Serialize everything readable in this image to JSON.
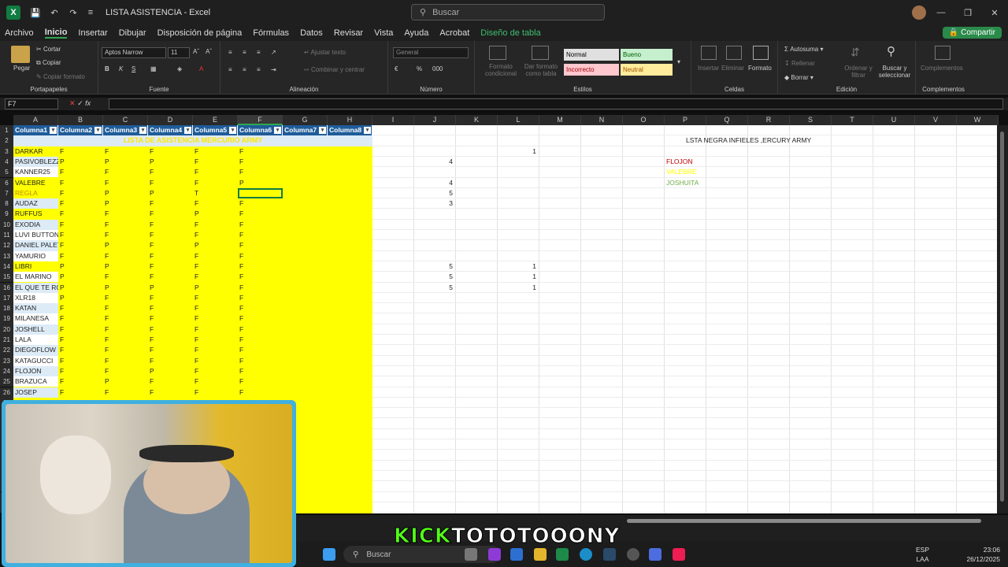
{
  "app": {
    "title": "LISTA ASISTENCIA",
    "app_name": "Excel",
    "search_placeholder": "Buscar"
  },
  "menu": {
    "items": [
      "Archivo",
      "Inicio",
      "Insertar",
      "Dibujar",
      "Disposición de página",
      "Fórmulas",
      "Datos",
      "Revisar",
      "Vista",
      "Ayuda",
      "Acrobat",
      "Diseño de tabla"
    ],
    "active": "Inicio",
    "share_label": "Compartir"
  },
  "ribbon": {
    "clipboard": {
      "paste": "Pegar",
      "cut": "Cortar",
      "copy": "Copiar",
      "format_painter": "Copiar formato",
      "label": "Portapapeles"
    },
    "font": {
      "name": "Aptos Narrow",
      "size": "11",
      "label": "Fuente"
    },
    "alignment": {
      "wrap": "Ajustar texto",
      "merge": "Combinar y centrar",
      "label": "Alineación"
    },
    "number": {
      "format": "General",
      "label": "Número"
    },
    "styles": {
      "cond": "Formato condicional",
      "table": "Dar formato como tabla",
      "normal": "Normal",
      "good": "Bueno",
      "bad": "Incorrecto",
      "neutral": "Neutral",
      "label": "Estilos"
    },
    "cells": {
      "insert": "Insertar",
      "delete": "Eliminar",
      "format": "Formato",
      "label": "Celdas"
    },
    "editing": {
      "autosum": "Autosuma",
      "fill": "Rellenar",
      "clear": "Borrar",
      "sort": "Ordenar y filtrar",
      "find": "Buscar y seleccionar",
      "label": "Edición"
    },
    "addins": {
      "label": "Complementos"
    }
  },
  "formula_bar": {
    "name_box": "F7",
    "fx": "fx",
    "value": ""
  },
  "columns": [
    "A",
    "B",
    "C",
    "D",
    "E",
    "F",
    "G",
    "H",
    "I",
    "J",
    "K",
    "L",
    "M",
    "N",
    "O",
    "P",
    "Q",
    "R",
    "S",
    "T",
    "U",
    "V",
    "W"
  ],
  "selected_column": "F",
  "table": {
    "headers": [
      "Columna1",
      "Columna2",
      "Columna3",
      "Columna4",
      "Columna5",
      "Columna6",
      "Columna7",
      "Columna8"
    ],
    "title_row": "LISTA DE ASISTENCIA MERCURIO ARMY",
    "rows": [
      {
        "name": "DARKAR",
        "v": [
          "F",
          "F",
          "F",
          "F",
          "F"
        ]
      },
      {
        "name": "PASIVOBLEZZ",
        "v": [
          "P",
          "P",
          "P",
          "F",
          "F"
        ]
      },
      {
        "name": "KANNER25",
        "v": [
          "F",
          "F",
          "F",
          "F",
          "F"
        ]
      },
      {
        "name": "VALEBRE",
        "v": [
          "F",
          "F",
          "F",
          "F",
          "P"
        ]
      },
      {
        "name": "REGLA",
        "v": [
          "F",
          "P",
          "P",
          "T",
          ""
        ]
      },
      {
        "name": "AUDAZ",
        "v": [
          "F",
          "P",
          "F",
          "F",
          "F"
        ]
      },
      {
        "name": "RUFFUS",
        "v": [
          "F",
          "F",
          "F",
          "P",
          "F"
        ]
      },
      {
        "name": "EXODIA",
        "v": [
          "F",
          "F",
          "F",
          "F",
          "F"
        ]
      },
      {
        "name": "LUVI BUTTON",
        "v": [
          "F",
          "F",
          "F",
          "F",
          "F"
        ]
      },
      {
        "name": "DANIEL PALET",
        "v": [
          "F",
          "P",
          "F",
          "P",
          "F"
        ]
      },
      {
        "name": "YAMURIO",
        "v": [
          "F",
          "F",
          "F",
          "F",
          "F"
        ]
      },
      {
        "name": "LIBRI",
        "v": [
          "P",
          "P",
          "F",
          "F",
          "F"
        ]
      },
      {
        "name": "EL MARINO",
        "v": [
          "P",
          "F",
          "F",
          "F",
          "F"
        ]
      },
      {
        "name": "EL QUE TE ROI",
        "v": [
          "P",
          "P",
          "P",
          "P",
          "F"
        ]
      },
      {
        "name": "XLR18",
        "v": [
          "P",
          "F",
          "F",
          "F",
          "F"
        ]
      },
      {
        "name": "KATAN",
        "v": [
          "F",
          "F",
          "F",
          "F",
          "F"
        ]
      },
      {
        "name": "MILANESA",
        "v": [
          "F",
          "F",
          "F",
          "F",
          "F"
        ]
      },
      {
        "name": "JOSHELL",
        "v": [
          "F",
          "F",
          "F",
          "F",
          "F"
        ]
      },
      {
        "name": "LALA",
        "v": [
          "F",
          "F",
          "F",
          "F",
          "F"
        ]
      },
      {
        "name": "DIEGOFLOW",
        "v": [
          "F",
          "F",
          "F",
          "F",
          "F"
        ]
      },
      {
        "name": "KATAGUCCI",
        "v": [
          "F",
          "F",
          "F",
          "F",
          "F"
        ]
      },
      {
        "name": "FLOJON",
        "v": [
          "F",
          "F",
          "P",
          "F",
          "F"
        ]
      },
      {
        "name": "BRAZUCA",
        "v": [
          "F",
          "P",
          "F",
          "F",
          "F"
        ]
      },
      {
        "name": "JOSEP",
        "v": [
          "F",
          "F",
          "F",
          "F",
          "F"
        ]
      }
    ]
  },
  "side_values": {
    "col_j": [
      {
        "row": 4,
        "v": "4"
      },
      {
        "row": 6,
        "v": "4"
      },
      {
        "row": 7,
        "v": "5"
      },
      {
        "row": 8,
        "v": "3"
      },
      {
        "row": 14,
        "v": "5"
      },
      {
        "row": 15,
        "v": "5"
      },
      {
        "row": 16,
        "v": "5"
      }
    ],
    "col_l": [
      {
        "row": 3,
        "v": "1"
      },
      {
        "row": 14,
        "v": "1"
      },
      {
        "row": 15,
        "v": "1"
      },
      {
        "row": 16,
        "v": "1"
      }
    ]
  },
  "blacklist": {
    "title": "LSTA NEGRA INFIELES ,ERCURY ARMY",
    "entries": [
      {
        "name": "FLOJON",
        "color": "#c00000"
      },
      {
        "name": "VALEBRE",
        "color": "#ffff00"
      },
      {
        "name": "JOSHUITA",
        "color": "#70ad47"
      }
    ]
  },
  "taskbar": {
    "search": "Buscar",
    "lang": "ESP",
    "lang2": "LAA",
    "time": "23:06",
    "date": "26/12/2025"
  },
  "overlay": {
    "kick": "KICK",
    "channel": "TOTOTOOONY"
  },
  "colors": {
    "accent": "#2fa84f",
    "header_blue": "#1f5c99",
    "row_yellow": "#ffff00",
    "row_blue": "#ddebf7",
    "webcam_border": "#3fb0e0"
  }
}
